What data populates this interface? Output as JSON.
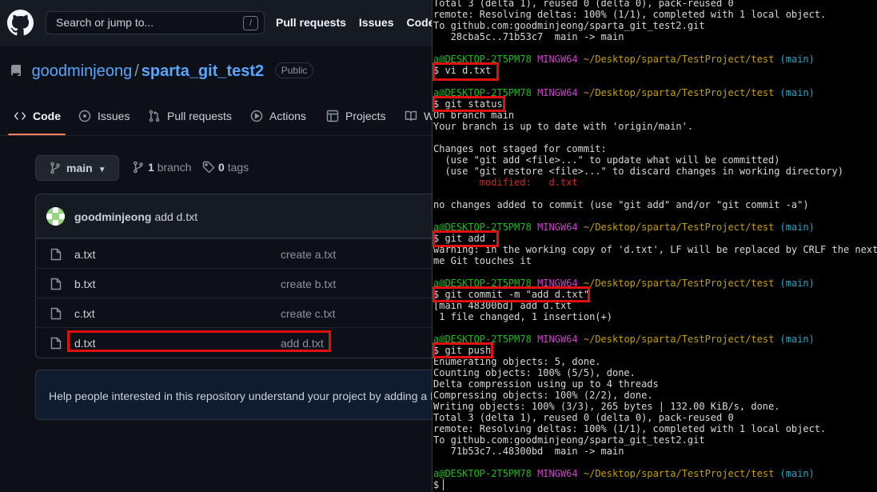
{
  "github": {
    "search_placeholder": "Search or jump to...",
    "search_shortcut": "/",
    "nav": [
      "Pull requests",
      "Issues",
      "Codespaces"
    ],
    "repo": {
      "owner": "goodminjeong",
      "separator": "/",
      "name": "sparta_git_test2",
      "visibility": "Public"
    },
    "tabs": [
      {
        "label": "Code",
        "icon": "code-icon",
        "active": true
      },
      {
        "label": "Issues",
        "icon": "issue-icon"
      },
      {
        "label": "Pull requests",
        "icon": "pull-request-icon"
      },
      {
        "label": "Actions",
        "icon": "play-icon"
      },
      {
        "label": "Projects",
        "icon": "table-icon"
      },
      {
        "label": "Wiki",
        "icon": "book-icon"
      }
    ],
    "branch": {
      "current": "main",
      "count": "1",
      "count_label": "branch",
      "tag_count": "0",
      "tag_label": "tags"
    },
    "latest_commit": {
      "author": "goodminjeong",
      "message": "add d.txt"
    },
    "files": [
      {
        "name": "a.txt",
        "commit": "create a.txt"
      },
      {
        "name": "b.txt",
        "commit": "create b.txt"
      },
      {
        "name": "c.txt",
        "commit": "create c.txt"
      },
      {
        "name": "d.txt",
        "commit": "add d.txt"
      }
    ],
    "about_message": "Help people interested in this repository understand your project by adding a README."
  },
  "terminal": {
    "prompt": {
      "user": "a@DESKTOP-2T5PM78",
      "system": "MINGW64",
      "path": "~/Desktop/sparta/TestProject/test",
      "branch": "(main)"
    },
    "lines": [
      {
        "text": "Total 3 (delta 1), reused 0 (delta 0), pack-reused 0"
      },
      {
        "text": "remote: Resolving deltas: 100% (1/1), completed with 1 local object."
      },
      {
        "text": "To github.com:goodminjeong/sparta_git_test2.git"
      },
      {
        "text": "   28cba5c..71b53c7  main -> main"
      },
      {
        "text": ""
      },
      {
        "prompt": true
      },
      {
        "text": "$ vi d.txt"
      },
      {
        "text": ""
      },
      {
        "prompt": true
      },
      {
        "text": "$ git status"
      },
      {
        "text": "On branch main"
      },
      {
        "text": "Your branch is up to date with 'origin/main'."
      },
      {
        "text": ""
      },
      {
        "text": "Changes not staged for commit:"
      },
      {
        "text": "  (use \"git add <file>...\" to update what will be committed)"
      },
      {
        "text": "  (use \"git restore <file>...\" to discard changes in working directory)"
      },
      {
        "text": "        modified:   d.txt",
        "red": true
      },
      {
        "text": ""
      },
      {
        "text": "no changes added to commit (use \"git add\" and/or \"git commit -a\")"
      },
      {
        "text": ""
      },
      {
        "prompt": true
      },
      {
        "text": "$ git add ."
      },
      {
        "text": "warning: in the working copy of 'd.txt', LF will be replaced by CRLF the next time Git touches it"
      },
      {
        "text": "me Git touches it"
      },
      {
        "text": ""
      },
      {
        "prompt": true
      },
      {
        "text": "$ git commit -m \"add d.txt\""
      },
      {
        "text": "[main 48300bd] add d.txt"
      },
      {
        "text": " 1 file changed, 1 insertion(+)"
      },
      {
        "text": ""
      },
      {
        "prompt": true
      },
      {
        "text": "$ git push"
      },
      {
        "text": "Enumerating objects: 5, done."
      },
      {
        "text": "Counting objects: 100% (5/5), done."
      },
      {
        "text": "Delta compression using up to 4 threads"
      },
      {
        "text": "Compressing objects: 100% (2/2), done."
      },
      {
        "text": "Writing objects: 100% (3/3), 265 bytes | 132.00 KiB/s, done."
      },
      {
        "text": "Total 3 (delta 1), reused 0 (delta 0), pack-reused 0"
      },
      {
        "text": "remote: Resolving deltas: 100% (1/1), completed with 1 local object."
      },
      {
        "text": "To github.com:goodminjeong/sparta_git_test2.git"
      },
      {
        "text": "   71b53c7..48300bd  main -> main"
      },
      {
        "text": ""
      },
      {
        "prompt": true
      },
      {
        "text": "$ "
      }
    ]
  },
  "colors": {
    "highlight_box": "#e01010",
    "link_blue": "#58a6ff",
    "tab_underline": "#f78166",
    "prompt_user": "#13c313",
    "prompt_path": "#c4a000"
  }
}
